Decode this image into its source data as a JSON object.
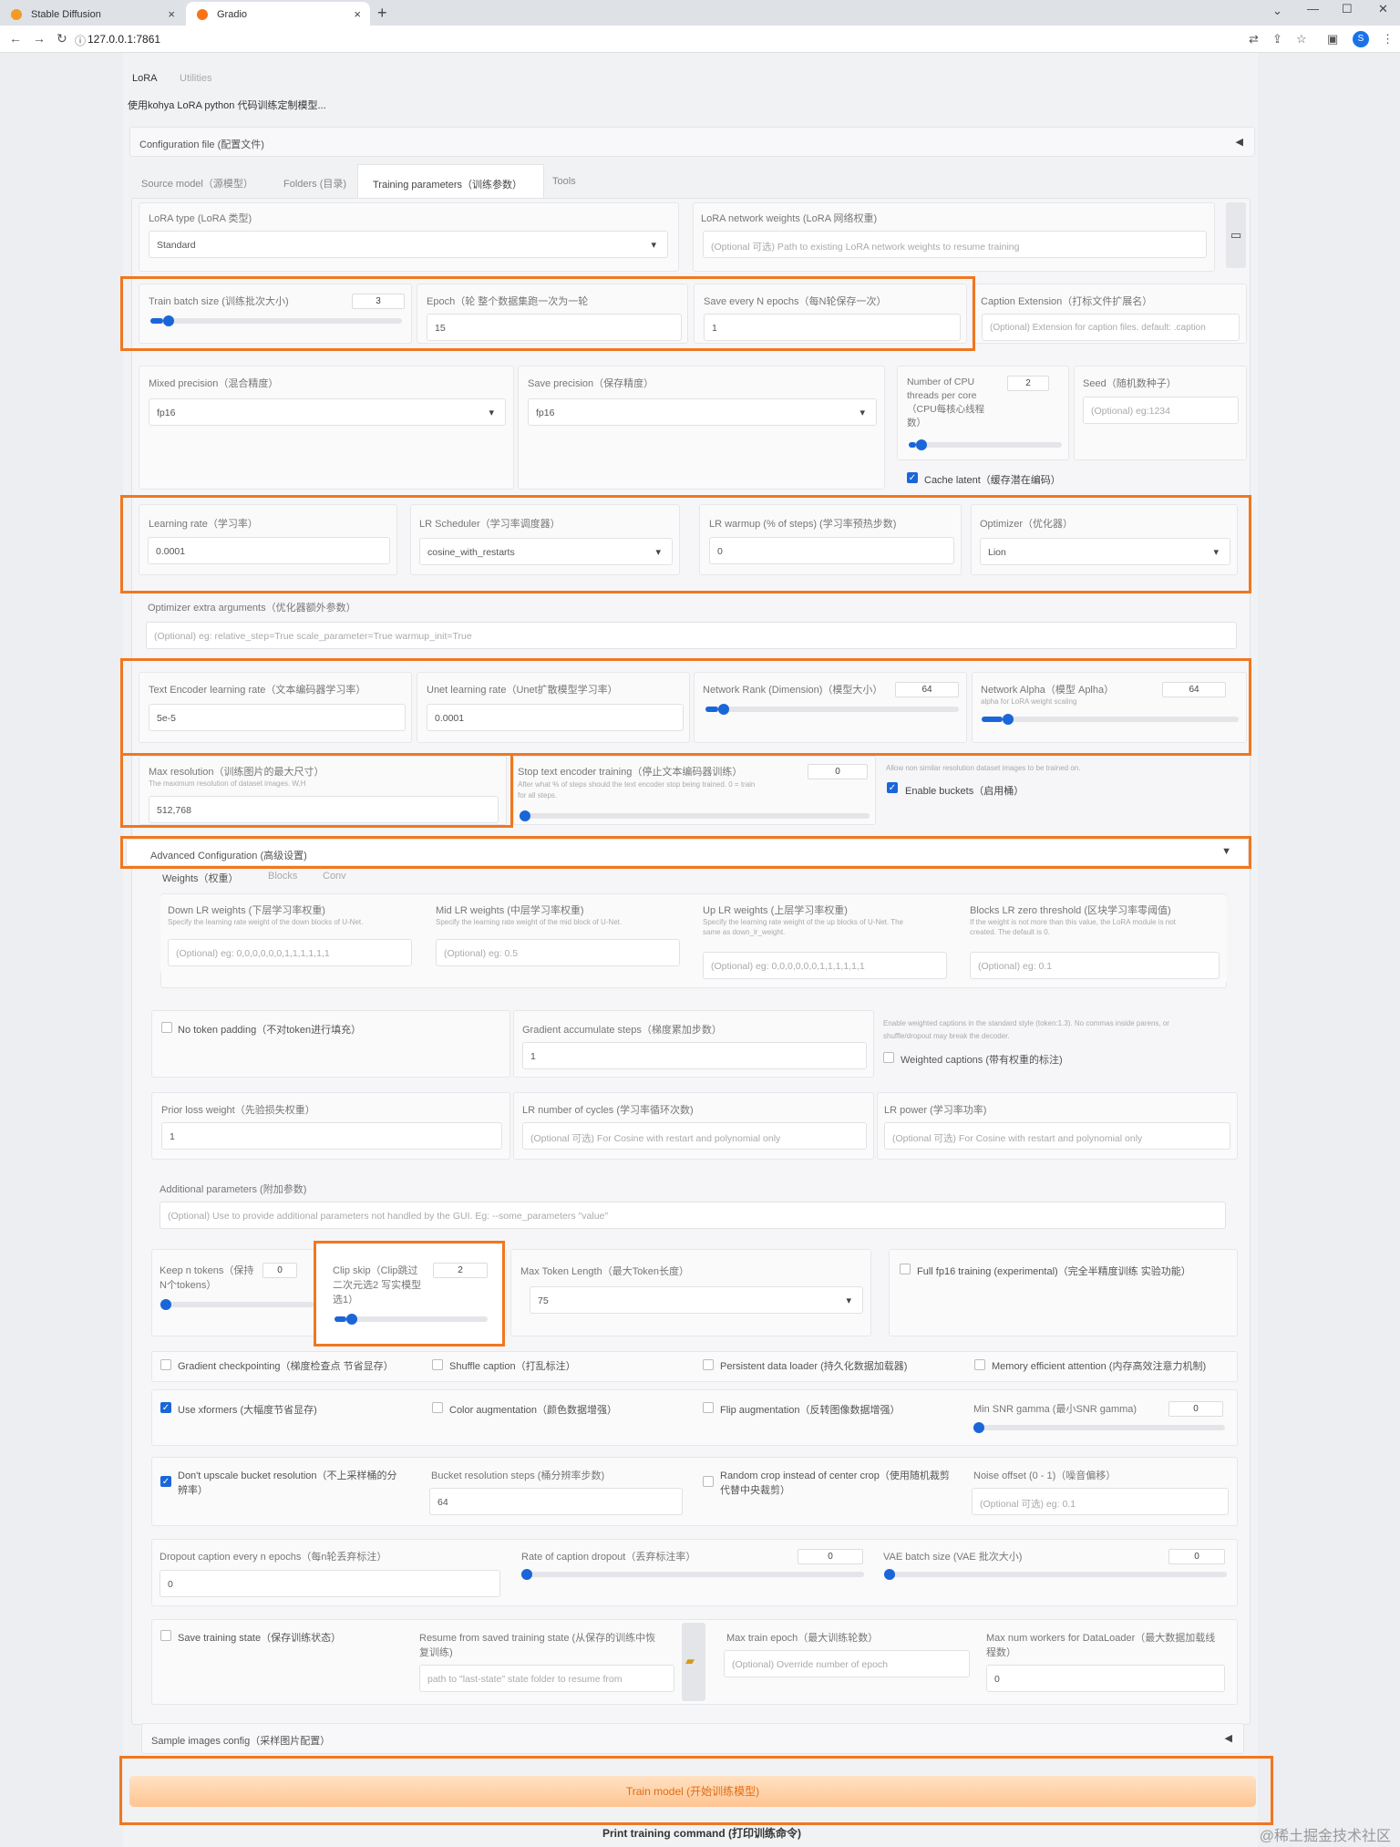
{
  "browser": {
    "tabs": [
      {
        "label": "Stable Diffusion"
      },
      {
        "label": "Gradio"
      }
    ],
    "url": "127.0.0.1:7861",
    "avatar": "S"
  },
  "app": {
    "top_tabs": [
      "LoRA",
      "Utilities"
    ],
    "intro": "使用kohya LoRA python 代码训练定制模型...",
    "config_file": "Configuration file (配置文件)",
    "section_tabs": [
      "Source model（源模型）",
      "Folders (目录)",
      "Training parameters（训练参数）",
      "Tools"
    ]
  },
  "params": {
    "lora_type": {
      "label": "LoRA type (LoRA 类型)",
      "value": "Standard"
    },
    "lora_weights": {
      "label": "LoRA network weights (LoRA 网络权重)",
      "placeholder": "(Optional 可选) Path to existing LoRA network weights to resume training"
    },
    "train_batch": {
      "label": "Train batch size (训练批次大小)",
      "value": "3",
      "fraction": 0.05
    },
    "epoch": {
      "label": "Epoch（轮 整个数据集跑一次为一轮",
      "value": "15"
    },
    "save_every": {
      "label": "Save every N epochs（每N轮保存一次）",
      "value": "1"
    },
    "caption_ext": {
      "label": "Caption Extension（打标文件扩展名）",
      "placeholder": "(Optional) Extension for caption files. default: .caption"
    },
    "mixed_precision": {
      "label": "Mixed precision（混合精度）",
      "value": "fp16"
    },
    "save_precision": {
      "label": "Save precision（保存精度）",
      "value": "fp16"
    },
    "cpu_threads": {
      "label": "Number of CPU threads per core（CPU每核心线程数）",
      "value": "2",
      "fraction": 0.05
    },
    "seed": {
      "label": "Seed（随机数种子）",
      "placeholder": "(Optional) eg:1234"
    },
    "cache_latent": {
      "label": "Cache latent（缓存潜在编码）",
      "checked": true
    },
    "learning_rate": {
      "label": "Learning rate（学习率）",
      "value": "0.0001"
    },
    "lr_scheduler": {
      "label": "LR Scheduler（学习率调度器）",
      "value": "cosine_with_restarts"
    },
    "lr_warmup": {
      "label": "LR warmup (% of steps) (学习率预热步数)",
      "value": "0"
    },
    "optimizer": {
      "label": "Optimizer（优化器）",
      "value": "Lion"
    },
    "optimizer_extra": {
      "label": "Optimizer extra arguments（优化器额外参数）",
      "placeholder": "(Optional) eg: relative_step=True scale_parameter=True warmup_init=True"
    },
    "text_encoder_lr": {
      "label": "Text Encoder learning rate（文本编码器学习率）",
      "value": "5e-5"
    },
    "unet_lr": {
      "label": "Unet learning rate（Unet扩散模型学习率）",
      "value": "0.0001"
    },
    "network_rank": {
      "label": "Network Rank (Dimension)（模型大小）",
      "value": "64",
      "fraction": 0.05
    },
    "network_alpha": {
      "label": "Network Alpha（模型 Aplha）",
      "sub": "alpha for LoRA weight scaling",
      "value": "64",
      "fraction": 0.08
    },
    "max_resolution": {
      "label": "Max resolution（训练图片的最大尺寸）",
      "sub": "The maximum resolution of dataset images. W,H",
      "value": "512,768"
    },
    "stop_text_encoder": {
      "label": "Stop text encoder training（停止文本编码器训练）",
      "sub1": "After what % of steps should the text encoder stop being trained. 0 = train",
      "sub2": "for all steps.",
      "value": "0",
      "fraction": 0
    },
    "enable_buckets": {
      "sub": "Allow non similar resolution dataset images to be trained on.",
      "label": "Enable buckets（启用桶）",
      "checked": true
    }
  },
  "advanced": {
    "title": "Advanced Configuration (高级设置)",
    "tabs": [
      "Weights（权重）",
      "Blocks",
      "Conv"
    ],
    "down_lr": {
      "label": "Down LR weights (下层学习率权重)",
      "sub": "Specify the learning rate weight of the down blocks of U-Net.",
      "placeholder": "(Optional) eg: 0,0,0,0,0,0,1,1,1,1,1,1"
    },
    "mid_lr": {
      "label": "Mid LR weights (中层学习率权重)",
      "sub": "Specify the learning rate weight of the mid block of U-Net.",
      "placeholder": "(Optional) eg: 0.5"
    },
    "up_lr": {
      "label": "Up LR weights (上层学习率权重)",
      "sub1": "Specify the learning rate weight of the up blocks of U-Net. The",
      "sub2": "same as down_lr_weight.",
      "placeholder": "(Optional) eg: 0,0,0,0,0,0,1,1,1,1,1,1"
    },
    "blocks_zero": {
      "label": "Blocks LR zero threshold (区块学习率零阈值)",
      "sub1": "If the weight is not more than this value, the LoRA module is not",
      "sub2": "created. The default is 0.",
      "placeholder": "(Optional) eg: 0.1"
    },
    "no_token_padding": {
      "label": "No token padding（不对token进行填充）",
      "checked": false
    },
    "grad_accum": {
      "label": "Gradient accumulate steps（梯度累加步数）",
      "value": "1"
    },
    "weighted_captions": {
      "sub1": "Enable weighted captions in the standard style (token:1.3). No commas inside parens, or",
      "sub2": "shuffle/dropout may break the decoder.",
      "label": "Weighted captions (带有权重的标注)",
      "checked": false
    },
    "prior_loss": {
      "label": "Prior loss weight（先验损失权重）",
      "value": "1"
    },
    "lr_cycles": {
      "label": "LR number of cycles (学习率循环次数)",
      "placeholder": "(Optional 可选) For Cosine with restart and polynomial only"
    },
    "lr_power": {
      "label": "LR power (学习率功率)",
      "placeholder": "(Optional 可选) For Cosine with restart and polynomial only"
    },
    "additional": {
      "label": "Additional parameters (附加参数)",
      "placeholder": "(Optional) Use to provide additional parameters not handled by the GUI. Eg: --some_parameters \"value\""
    },
    "keep_tokens": {
      "label1": "Keep n tokens（保持",
      "label2": "N个tokens）",
      "value": "0",
      "fraction": 0
    },
    "clip_skip": {
      "label1": "Clip skip（Clip跳过",
      "label2": "二次元选2 写实模型",
      "label3": "选1）",
      "value": "2",
      "fraction": 0.08
    },
    "max_token": {
      "label": "Max Token Length（最大Token长度）",
      "value": "75"
    },
    "full_fp16": {
      "label": "Full fp16 training (experimental)（完全半精度训练 实验功能）",
      "checked": false
    },
    "grad_ckpt": {
      "label": "Gradient checkpointing（梯度检查点 节省显存）",
      "checked": false
    },
    "shuffle_caption": {
      "label": "Shuffle caption（打乱标注）",
      "checked": false
    },
    "persistent_loader": {
      "label": "Persistent data loader (持久化数据加载器)",
      "checked": false
    },
    "mem_eff_attn": {
      "label": "Memory efficient attention (内存高效注意力机制)",
      "checked": false
    },
    "use_xformers": {
      "label": "Use xformers (大幅度节省显存)",
      "checked": true
    },
    "color_aug": {
      "label": "Color augmentation（颜色数据增强）",
      "checked": false
    },
    "flip_aug": {
      "label": "Flip augmentation（反转图像数据增强）",
      "checked": false
    },
    "min_snr": {
      "label": "Min SNR gamma (最小SNR gamma)",
      "value": "0",
      "fraction": 0
    },
    "no_upscale": {
      "label1": "Don't upscale bucket resolution（不上采样桶的分",
      "label2": "辨率）",
      "checked": true
    },
    "bucket_steps": {
      "label": "Bucket resolution steps (桶分辨率步数)",
      "value": "64"
    },
    "random_crop": {
      "label1": "Random crop instead of center crop（使用随机裁剪",
      "label2": "代替中央裁剪）",
      "checked": false
    },
    "noise_offset": {
      "label": "Noise offset (0 - 1)（噪音偏移）",
      "placeholder": "(Optional 可选) eg: 0.1"
    },
    "dropout_caption": {
      "label": "Dropout caption every n epochs（每n轮丢弃标注）",
      "value": "0"
    },
    "caption_dropout_rate": {
      "label": "Rate of caption dropout（丢弃标注率）",
      "value": "0",
      "fraction": 0
    },
    "vae_batch": {
      "label": "VAE batch size (VAE 批次大小)",
      "value": "0",
      "fraction": 0
    },
    "save_state": {
      "label": "Save training state（保存训练状态）",
      "checked": false
    },
    "resume": {
      "label1": "Resume from saved training state (从保存的训练中恢",
      "label2": "复训练)",
      "placeholder": "path to \"last-state\" state folder to resume from"
    },
    "max_train_epoch": {
      "label": "Max train epoch（最大训练轮数）",
      "placeholder": "(Optional) Override number of epoch"
    },
    "max_workers": {
      "label1": "Max num workers for DataLoader（最大数据加载线",
      "label2": "程数）",
      "value": "0"
    }
  },
  "sample_images": "Sample images config（采样图片配置）",
  "buttons": {
    "train": "Train model (开始训练模型)",
    "print": "Print training command (打印训练命令)"
  },
  "watermark": "@稀土掘金技术社区",
  "colors": {
    "highlight": "#f0771f",
    "slider": "#1a66d9"
  }
}
